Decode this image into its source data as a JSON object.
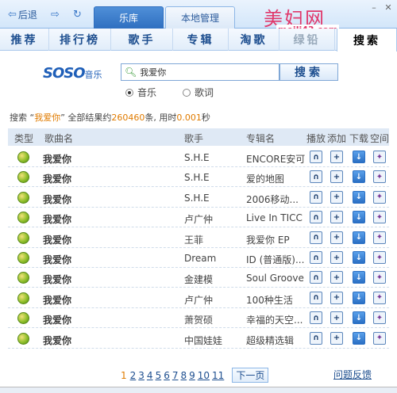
{
  "nav": {
    "back": "后退",
    "back_icon": "arrow-left-icon",
    "forward_icon": "arrow-right-icon",
    "refresh_icon": "refresh-icon"
  },
  "tabs": [
    {
      "label": "乐库"
    },
    {
      "label": "本地管理"
    }
  ],
  "brand": {
    "name": "美妇网",
    "url": "meili43.com"
  },
  "categories": [
    "推荐",
    "排行榜",
    "歌手",
    "专辑",
    "淘歌",
    "绿铅",
    "搜索"
  ],
  "search": {
    "logo": "SOSO",
    "logo_suffix": "音乐",
    "query": "我爱你",
    "button": "搜索",
    "options": [
      {
        "label": "音乐",
        "selected": true
      },
      {
        "label": "歌词",
        "selected": false
      }
    ]
  },
  "summary": {
    "prefix": "搜索 “",
    "keyword": "我爱你",
    "middle": "” 全部结果约",
    "count": "260460",
    "suffix": "条, 用时",
    "time": "0.001",
    "unit": "秒"
  },
  "columns": {
    "type": "类型",
    "song": "歌曲名",
    "artist": "歌手",
    "album": "专辑名",
    "play": "播放",
    "add": "添加",
    "download": "下载",
    "space": "空间"
  },
  "rows": [
    {
      "song": "我爱你",
      "artist": "S.H.E",
      "album": "ENCORE安可"
    },
    {
      "song": "我爱你",
      "artist": "S.H.E",
      "album": "爱的地图"
    },
    {
      "song": "我爱你",
      "artist": "S.H.E",
      "album": "2006移动..."
    },
    {
      "song": "我爱你",
      "artist": "卢广仲",
      "album": "Live In TICC"
    },
    {
      "song": "我爱你",
      "artist": "王菲",
      "album": "我爱你 EP"
    },
    {
      "song": "我爱你",
      "artist": "Dream",
      "album": "ID (普通版)..."
    },
    {
      "song": "我爱你",
      "artist": "金建模",
      "album": "Soul Groove"
    },
    {
      "song": "我爱你",
      "artist": "卢广仲",
      "album": "100种生活"
    },
    {
      "song": "我爱你",
      "artist": "萧贺硕",
      "album": "幸福的天空..."
    },
    {
      "song": "我爱你",
      "artist": "中国娃娃",
      "album": "超级精选辑"
    }
  ],
  "pager": {
    "current": "1",
    "pages": [
      "2",
      "3",
      "4",
      "5",
      "6",
      "7",
      "8",
      "9",
      "10",
      "11"
    ],
    "next": "下一页"
  },
  "feedback": "问题反馈"
}
